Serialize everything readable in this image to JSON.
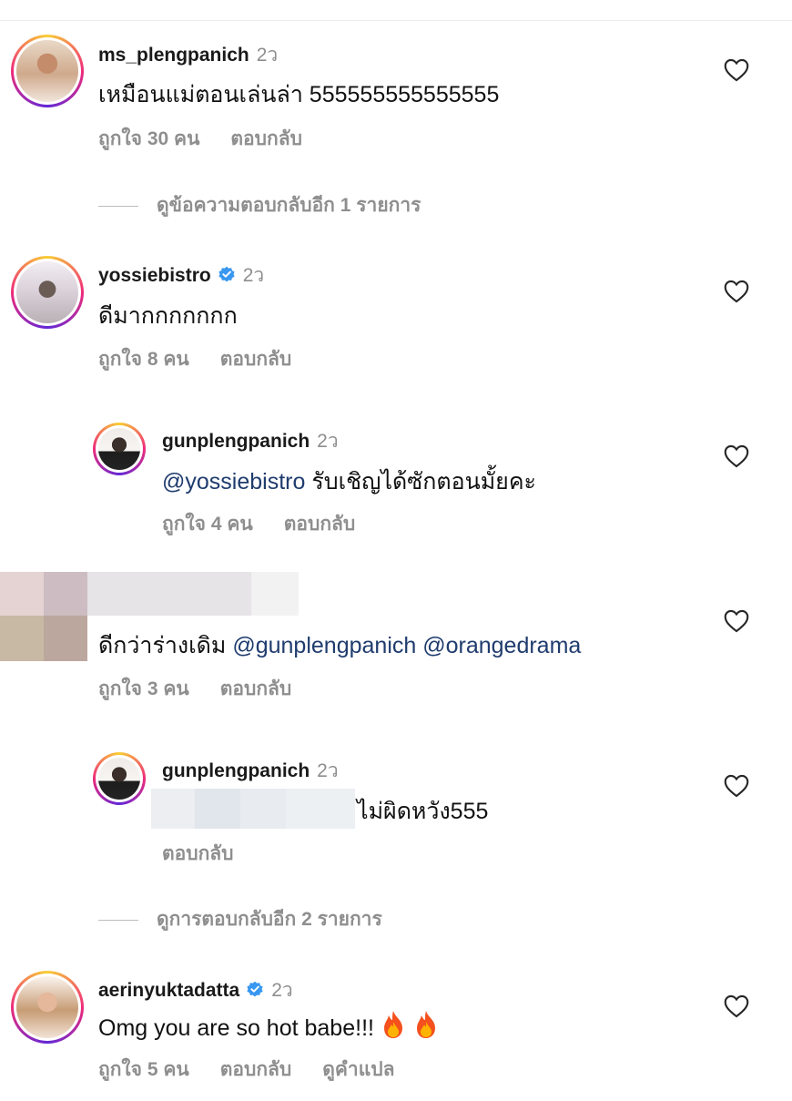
{
  "comments": [
    {
      "username": "ms_plengpanich",
      "time": "2ว",
      "text": "เหมือนแม่ตอนเล่นล่า 555555555555555",
      "likes": "ถูกใจ 30 คน",
      "reply": "ตอบกลับ",
      "more_replies": "ดูข้อความตอบกลับอีก 1 รายการ"
    },
    {
      "username": "yossiebistro",
      "time": "2ว",
      "text": "ดีมากกกกกกก",
      "likes": "ถูกใจ 8 คน",
      "reply": "ตอบกลับ"
    },
    {
      "username": "gunplengpanich",
      "time": "2ว",
      "mention": "@yossiebistro",
      "text": "รับเชิญได้ซักตอนมั้ยคะ",
      "likes": "ถูกใจ 4 คน",
      "reply": "ตอบกลับ"
    },
    {
      "text": "ดีกว่าร่างเดิม",
      "mention1": "@gunplengpanich",
      "mention2": "@orangedrama",
      "likes": "ถูกใจ 3 คน",
      "reply": "ตอบกลับ"
    },
    {
      "username": "gunplengpanich",
      "time": "2ว",
      "text": "ไม่ผิดหวัง555",
      "reply": "ตอบกลับ",
      "more_replies": "ดูการตอบกลับอีก 2 รายการ"
    },
    {
      "username": "aerinyuktadatta",
      "time": "2ว",
      "text": "Omg you are so hot babe!!!",
      "likes": "ถูกใจ 5 คน",
      "reply": "ตอบกลับ",
      "translate": "ดูคำแปล"
    }
  ],
  "colors": {
    "mention": "#1f3c6e",
    "muted": "#8e8e8e",
    "verified": "#3897f0"
  },
  "icons": {
    "like": "heart-outline-icon",
    "verified": "verified-badge-icon",
    "emoji": "fire-emoji-icon"
  }
}
